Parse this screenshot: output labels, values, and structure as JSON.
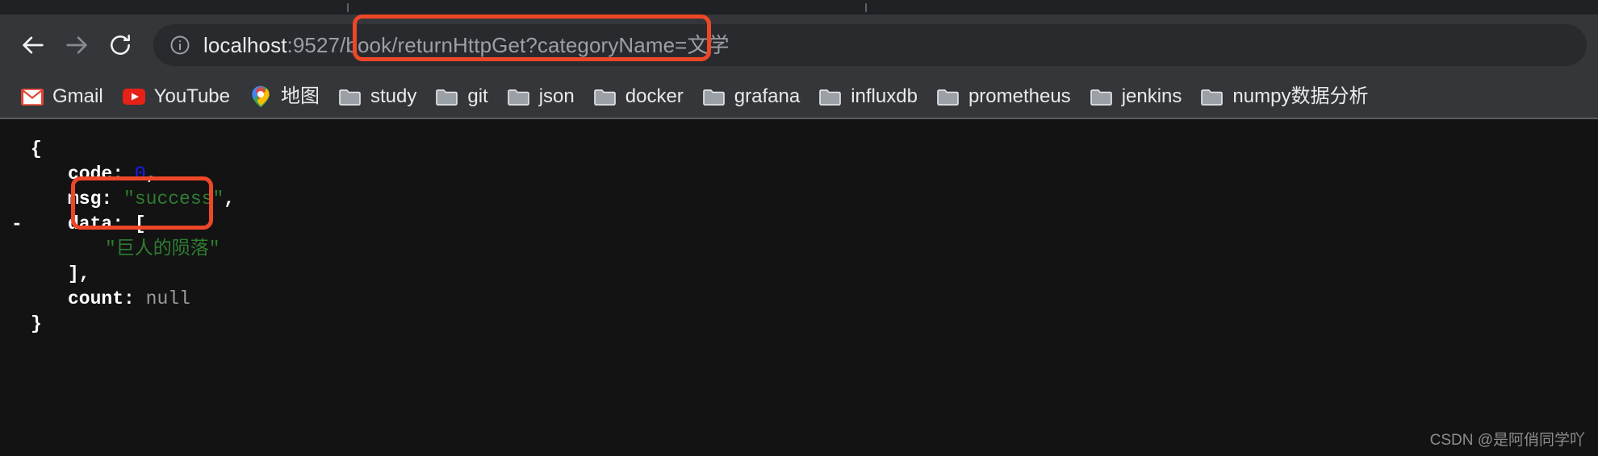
{
  "browser": {
    "tab_strip": {
      "tab_marks": 2
    },
    "nav": {
      "back_label": "Back",
      "forward_label": "Forward",
      "reload_label": "Reload"
    },
    "omnibox": {
      "info_icon": "info-circle-icon",
      "url_full": "localhost:9527/book/returnHttpGet?categoryName=文学",
      "url_host": "localhost",
      "url_rest": ":9527/book/returnHttpGet?categoryName=文学"
    },
    "bookmarks": [
      {
        "label": "Gmail",
        "icon": "gmail-icon"
      },
      {
        "label": "YouTube",
        "icon": "youtube-icon"
      },
      {
        "label": "地图",
        "icon": "google-maps-icon"
      },
      {
        "label": "study",
        "icon": "folder-icon"
      },
      {
        "label": "git",
        "icon": "folder-icon"
      },
      {
        "label": "json",
        "icon": "folder-icon"
      },
      {
        "label": "docker",
        "icon": "folder-icon"
      },
      {
        "label": "grafana",
        "icon": "folder-icon"
      },
      {
        "label": "influxdb",
        "icon": "folder-icon"
      },
      {
        "label": "prometheus",
        "icon": "folder-icon"
      },
      {
        "label": "jenkins",
        "icon": "folder-icon"
      },
      {
        "label": "numpy数据分析",
        "icon": "folder-icon"
      }
    ]
  },
  "json_response": {
    "open_brace": "{",
    "close_brace": "}",
    "fold_marker": "-",
    "code": {
      "key": "code:",
      "value": "0",
      "trailing": ","
    },
    "msg": {
      "key": "msg:",
      "value": "\"success\"",
      "trailing": ","
    },
    "data": {
      "key": "data:",
      "open_bracket": "[",
      "items": [
        "\"巨人的陨落\""
      ],
      "close_bracket": "],"
    },
    "count": {
      "key": "count:",
      "value": "null"
    }
  },
  "annotations": {
    "highlight_color": "#ee4727",
    "url_box_target": "/returnHttpGet?categoryName=文学",
    "data_box_target": "\"巨人的陨落\""
  },
  "watermark": {
    "text": "CSDN @是阿俏同学吖"
  }
}
